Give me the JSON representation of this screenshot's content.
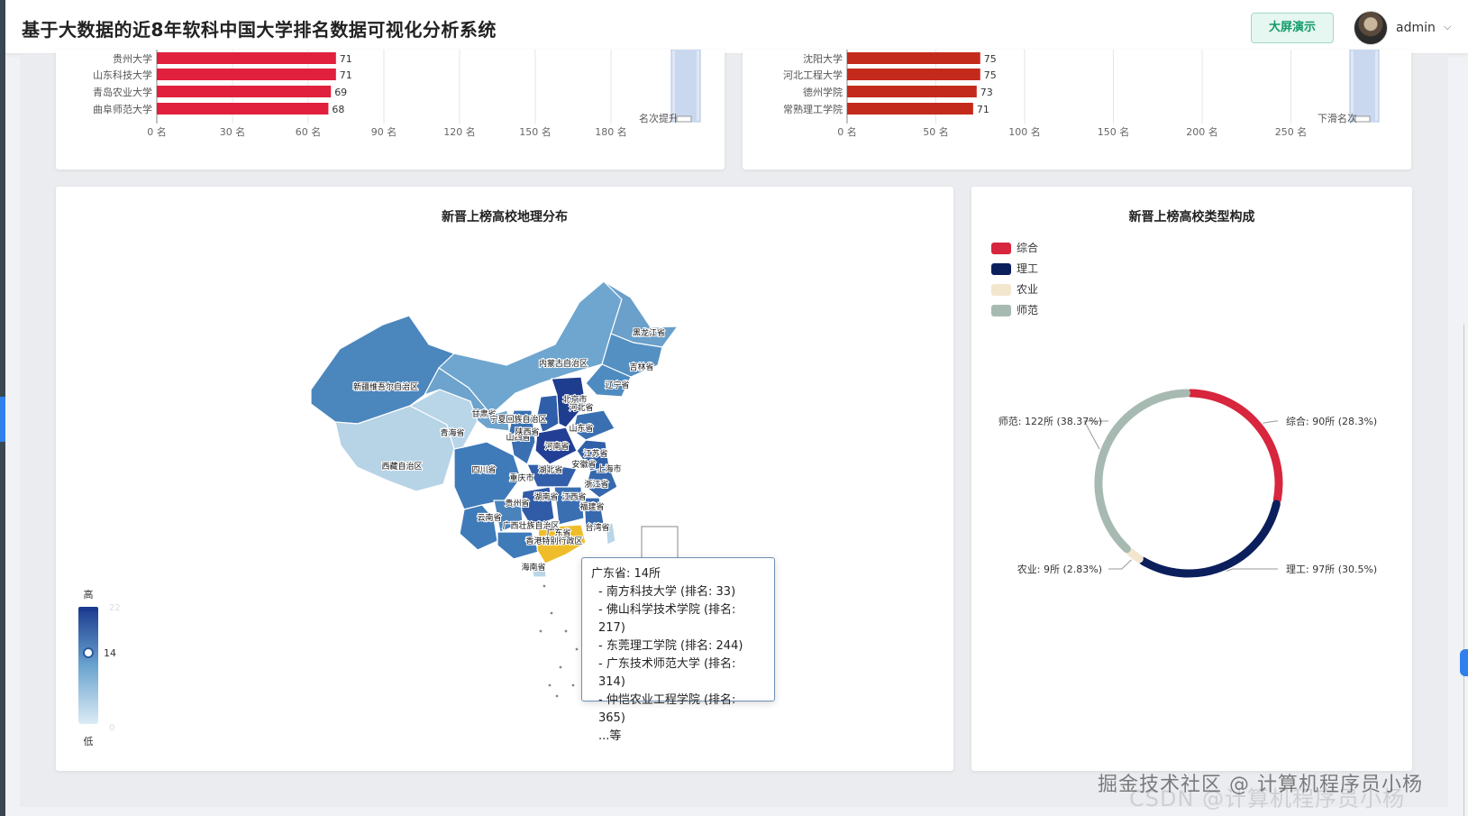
{
  "header": {
    "title": "基于大数据的近8年软科中国大学排名数据可视化分析系统",
    "bigscreen_button": "大屏演示",
    "user_name": "admin",
    "caret": "⌵"
  },
  "rising_chart": {
    "type": "bar",
    "categories": [
      "贵州大学",
      "山东科技大学",
      "青岛农业大学",
      "曲阜师范大学"
    ],
    "values": [
      71,
      71,
      69,
      68
    ],
    "x_ticks": [
      "0 名",
      "30 名",
      "60 名",
      "90 名",
      "120 名",
      "150 名",
      "180 名"
    ],
    "xlim": [
      0,
      210
    ],
    "slider_label": "名次提升",
    "bar_color": "#e0203c"
  },
  "falling_chart": {
    "type": "bar",
    "categories": [
      "沈阳大学",
      "河北工程大学",
      "德州学院",
      "常熟理工学院"
    ],
    "values": [
      75,
      75,
      73,
      71
    ],
    "x_ticks": [
      "0 名",
      "50 名",
      "100 名",
      "150 名",
      "200 名",
      "250 名"
    ],
    "xlim": [
      0,
      300
    ],
    "slider_label": "下滑名次",
    "bar_color": "#c42a1c"
  },
  "map_card": {
    "title": "新晋上榜高校地理分布",
    "visual_map": {
      "high_label": "高",
      "low_label": "低",
      "max": "22",
      "min": "0",
      "current": "14"
    },
    "province_labels": [
      "黑龙江省",
      "内蒙古自治区",
      "吉林省",
      "辽宁省",
      "新疆维吾尔自治区",
      "甘肃省",
      "宁夏回族自治区",
      "北京市",
      "河北省",
      "山西省",
      "山东省",
      "青海省",
      "陕西省",
      "河南省",
      "江苏省",
      "安徽省",
      "上海市",
      "西藏自治区",
      "四川省",
      "湖北省",
      "重庆市",
      "浙江省",
      "湖南省",
      "江西省",
      "贵州省",
      "福建省",
      "云南省",
      "广西壮族自治区",
      "广东省",
      "台湾省",
      "香港特别行政区",
      "海南省"
    ],
    "tooltip": {
      "header": "广东省: 14所",
      "items": [
        "- 南方科技大学 (排名: 33)",
        "- 佛山科学技术学院 (排名: 217)",
        "- 东莞理工学院 (排名: 244)",
        "- 广东技术师范大学 (排名: 314)",
        "- 仲恺农业工程学院 (排名: 365)"
      ],
      "more": "...等"
    }
  },
  "type_card": {
    "title": "新晋上榜高校类型构成",
    "legend": [
      {
        "name": "综合",
        "color": "#d7263d"
      },
      {
        "name": "理工",
        "color": "#0b1f5c"
      },
      {
        "name": "农业",
        "color": "#f3e6cf"
      },
      {
        "name": "师范",
        "color": "#a7bab2"
      }
    ],
    "chart_data": {
      "type": "pie",
      "slices": [
        {
          "name": "综合",
          "value": 90,
          "percent": 28.3,
          "label": "综合: 90所 (28.3%)"
        },
        {
          "name": "理工",
          "value": 97,
          "percent": 30.5,
          "label": "理工: 97所 (30.5%)"
        },
        {
          "name": "农业",
          "value": 9,
          "percent": 2.83,
          "label": "农业: 9所 (2.83%)"
        },
        {
          "name": "师范",
          "value": 122,
          "percent": 38.37,
          "label": "师范: 122所 (38.37%)"
        }
      ]
    }
  },
  "watermark": {
    "primary": "掘金技术社区 @ 计算机程序员小杨",
    "secondary": "CSDN @计算机程序员小杨"
  }
}
